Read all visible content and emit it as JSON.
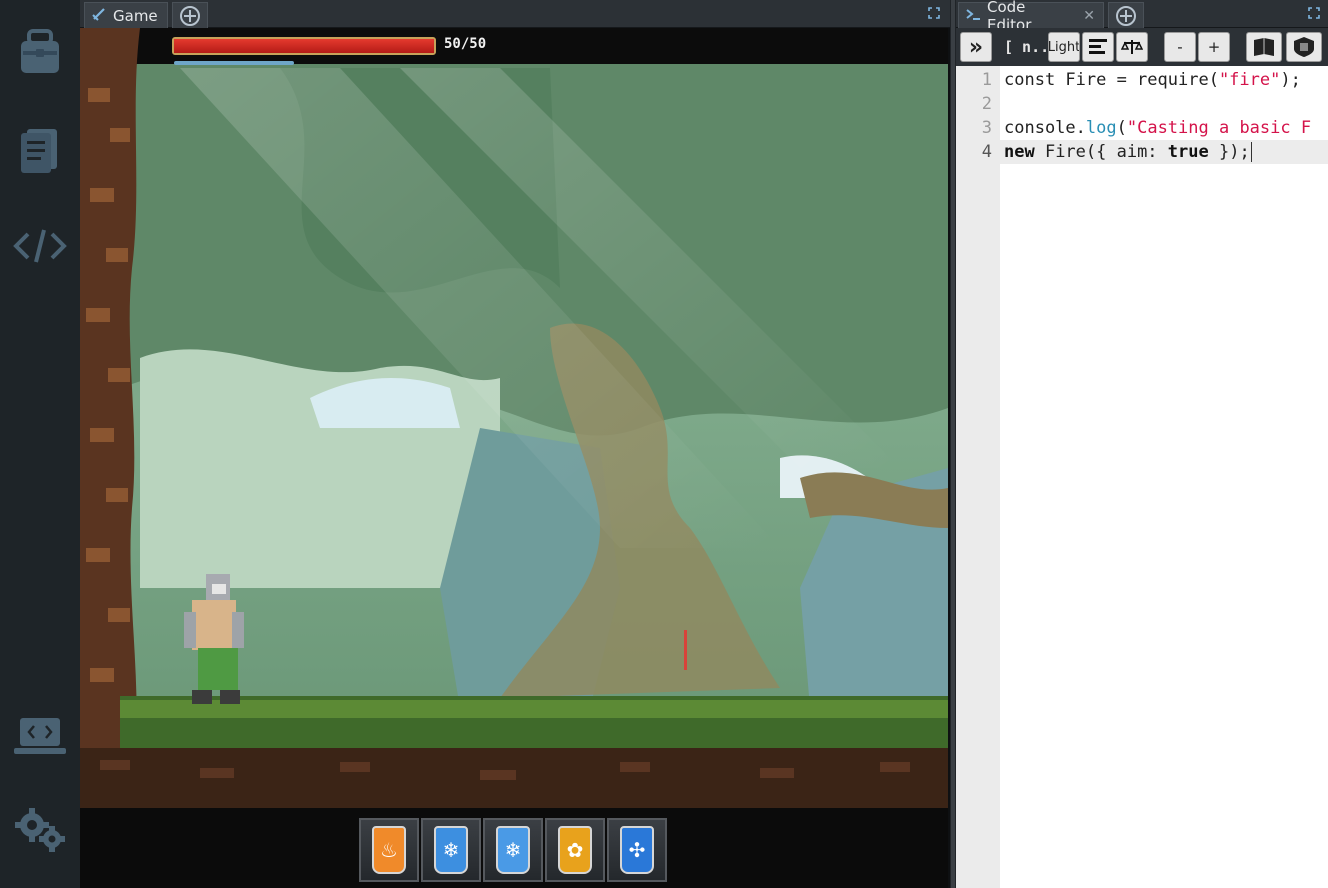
{
  "sidebar": {
    "items": [
      {
        "icon": "backpack-icon"
      },
      {
        "icon": "document-icon"
      },
      {
        "icon": "code-icon"
      },
      {
        "icon": "laptop-code-icon"
      },
      {
        "icon": "gears-icon"
      }
    ]
  },
  "game_panel": {
    "tab_label": "Game",
    "hud": {
      "hp_text": "50/50",
      "hp_current": 50,
      "hp_max": 50
    },
    "hotbar": [
      {
        "name": "fire-spell",
        "color": "#f08a2a",
        "glyph": "♨"
      },
      {
        "name": "ice-spell",
        "color": "#3d8fe0",
        "glyph": "❄"
      },
      {
        "name": "ice-spell-2",
        "color": "#4a9ae6",
        "glyph": "❄"
      },
      {
        "name": "earth-spell",
        "color": "#e8a21c",
        "glyph": "✿"
      },
      {
        "name": "nature-spell",
        "color": "#2a78d8",
        "glyph": "✣"
      }
    ]
  },
  "editor": {
    "tab_label": "Code Editor",
    "toolbar": {
      "run": "»",
      "file_label": "[ n...",
      "theme_label": "Light",
      "minus": "-",
      "plus": "+"
    },
    "lines": [
      {
        "no": "1"
      },
      {
        "no": "2"
      },
      {
        "no": "3"
      },
      {
        "no": "4"
      }
    ],
    "code": {
      "l1_a": "const Fire = require(",
      "l1_str": "\"fire\"",
      "l1_b": ");",
      "l3_a": "console.",
      "l3_fn": "log",
      "l3_b": "(",
      "l3_str": "\"Casting a basic F",
      "l4_kw1": "new",
      "l4_a": " Fire({ aim: ",
      "l4_kw2": "true",
      "l4_b": " });"
    }
  },
  "colors": {
    "hp_fill": "#d52a20",
    "string": "#d4134a",
    "function": "#2a8fb5"
  }
}
